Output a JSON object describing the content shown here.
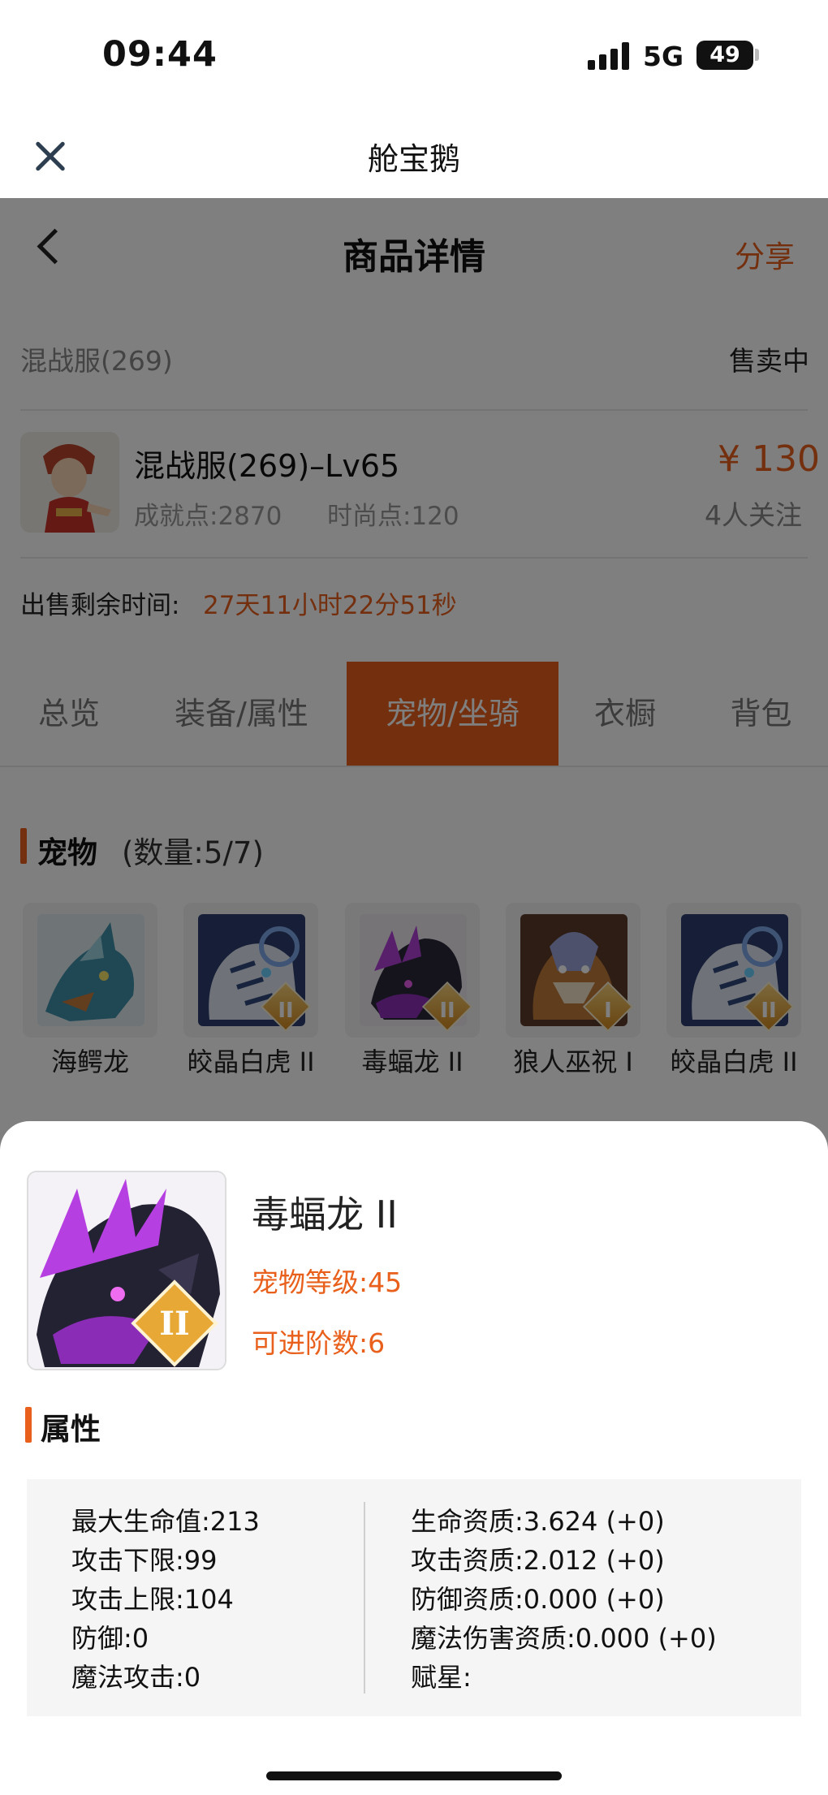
{
  "status_bar": {
    "time": "09:44",
    "network": "5G",
    "battery": "49"
  },
  "webview": {
    "title": "舱宝鹅"
  },
  "nav": {
    "title": "商品详情",
    "share": "分享"
  },
  "listing": {
    "server": "混战服(269)",
    "sale_status": "售卖中",
    "role_name": "混战服(269)–Lv65",
    "achievement": "成就点:2870",
    "fashion": "时尚点:120",
    "price": "¥ 130",
    "followers": "4人关注",
    "remaining_label": "出售剩余时间:",
    "remaining_value": "27天11小时22分51秒"
  },
  "tabs": [
    {
      "label": "总览",
      "active": false
    },
    {
      "label": "装备/属性",
      "active": false
    },
    {
      "label": "宠物/坐骑",
      "active": true
    },
    {
      "label": "衣橱",
      "active": false
    },
    {
      "label": "背包",
      "active": false
    }
  ],
  "pets_section": {
    "title": "宠物",
    "count": "(数量:5/7)",
    "items": [
      {
        "name": "海鳄龙",
        "icon": "sea-dragon-icon",
        "badge": ""
      },
      {
        "name": "皎晶白虎 II",
        "icon": "white-tiger-icon",
        "badge": "II"
      },
      {
        "name": "毒蝠龙 II",
        "icon": "venom-dragon-icon",
        "badge": "II"
      },
      {
        "name": "狼人巫祝 I",
        "icon": "werewolf-shaman-icon",
        "badge": "I"
      },
      {
        "name": "皎晶白虎 II",
        "icon": "white-tiger-icon",
        "badge": "II"
      }
    ]
  },
  "detail": {
    "name": "毒蝠龙 II",
    "level": "宠物等级:45",
    "advance": "可进阶数:6",
    "badge": "II",
    "attr_title": "属性",
    "left_attrs": [
      "最大生命值:213",
      "攻击下限:99",
      "攻击上限:104",
      "防御:0",
      "魔法攻击:0"
    ],
    "right_attrs": [
      "生命资质:3.624 (+0)",
      "攻击资质:2.012 (+0)",
      "防御资质:0.000 (+0)",
      "魔法伤害资质:0.000 (+0)",
      "赋星:"
    ]
  },
  "colors": {
    "accent": "#e8601c",
    "overlay": "rgba(0,0,0,0.5)"
  }
}
